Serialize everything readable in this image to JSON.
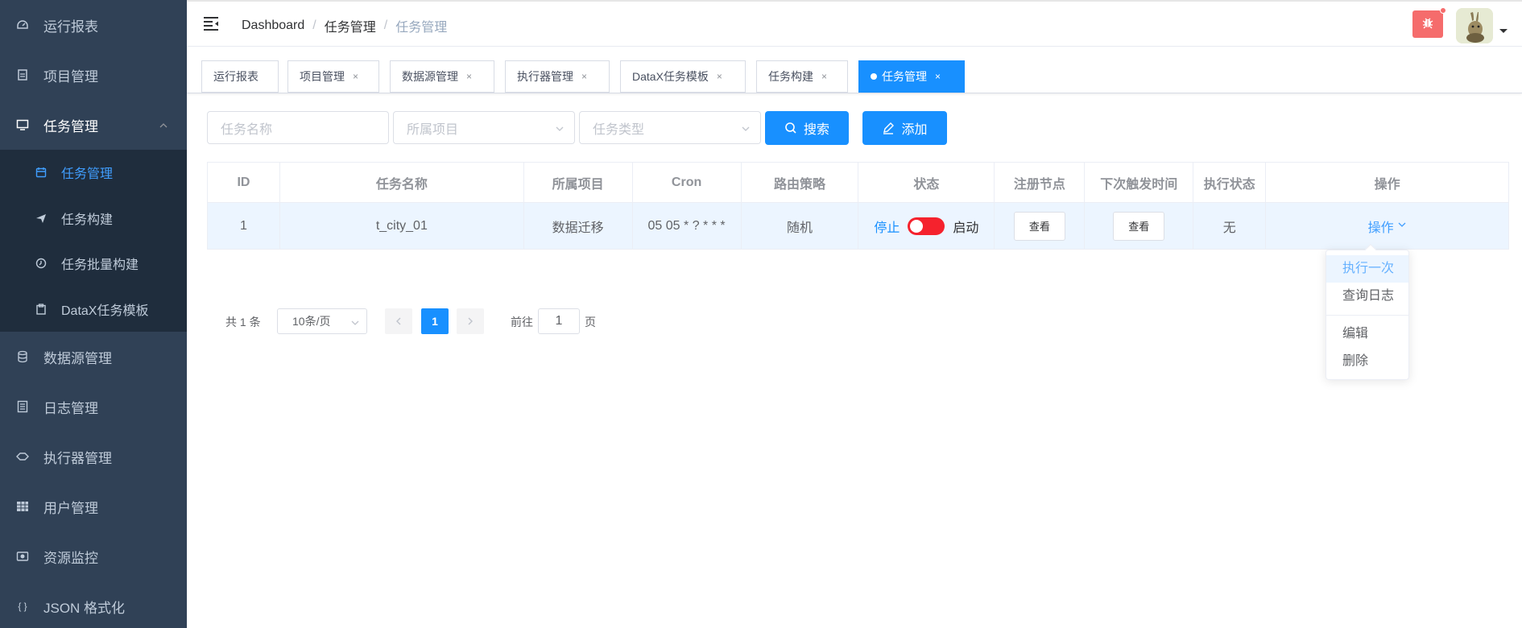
{
  "sidebar": {
    "items": [
      {
        "label": "运行报表",
        "icon": "dashboard-icon"
      },
      {
        "label": "项目管理",
        "icon": "project-icon"
      },
      {
        "label": "任务管理",
        "icon": "monitor-icon"
      },
      {
        "label": "数据源管理",
        "icon": "database-icon"
      },
      {
        "label": "日志管理",
        "icon": "log-icon"
      },
      {
        "label": "执行器管理",
        "icon": "executor-icon"
      },
      {
        "label": "用户管理",
        "icon": "user-table-icon"
      },
      {
        "label": "资源监控",
        "icon": "resource-icon"
      },
      {
        "label": "JSON 格式化",
        "icon": "json-icon"
      }
    ],
    "submenu": [
      {
        "label": "任务管理",
        "icon": "calendar-icon"
      },
      {
        "label": "任务构建",
        "icon": "send-icon"
      },
      {
        "label": "任务批量构建",
        "icon": "clock-icon"
      },
      {
        "label": "DataX任务模板",
        "icon": "clipboard-icon"
      }
    ]
  },
  "breadcrumb": {
    "root": "Dashboard",
    "parent": "任务管理",
    "current": "任务管理"
  },
  "tags": [
    {
      "label": "运行报表",
      "closable": false
    },
    {
      "label": "项目管理",
      "closable": true
    },
    {
      "label": "数据源管理",
      "closable": true
    },
    {
      "label": "执行器管理",
      "closable": true
    },
    {
      "label": "DataX任务模板",
      "closable": true
    },
    {
      "label": "任务构建",
      "closable": true
    },
    {
      "label": "任务管理",
      "closable": true,
      "active": true
    }
  ],
  "close_glyph": "×",
  "filter": {
    "name_placeholder": "任务名称",
    "project_placeholder": "所属项目",
    "type_placeholder": "任务类型",
    "search_label": "搜索",
    "add_label": "添加"
  },
  "table": {
    "headers": [
      "ID",
      "任务名称",
      "所属项目",
      "Cron",
      "路由策略",
      "状态",
      "注册节点",
      "下次触发时间",
      "执行状态",
      "操作"
    ],
    "rows": [
      {
        "id": "1",
        "name": "t_city_01",
        "project": "数据迁移",
        "cron": "05 05 * ? * * *",
        "route": "随机",
        "status_off": "停止",
        "status_on": "启动",
        "nodes_btn": "查看",
        "next_btn": "查看",
        "exec_status": "无",
        "op_label": "操作"
      }
    ]
  },
  "dropdown": {
    "items": [
      "执行一次",
      "查询日志",
      "编辑",
      "删除"
    ]
  },
  "pagination": {
    "total": "共 1 条",
    "page_size": "10条/页",
    "current": "1",
    "goto_label": "前往",
    "goto_value": "1",
    "page_suffix": "页"
  },
  "colors": {
    "sidebar_bg": "#304156",
    "submenu_bg": "#1f2d3d",
    "primary": "#1890ff",
    "switch_off": "#f5222d",
    "bug_btn": "#f56c6c"
  }
}
